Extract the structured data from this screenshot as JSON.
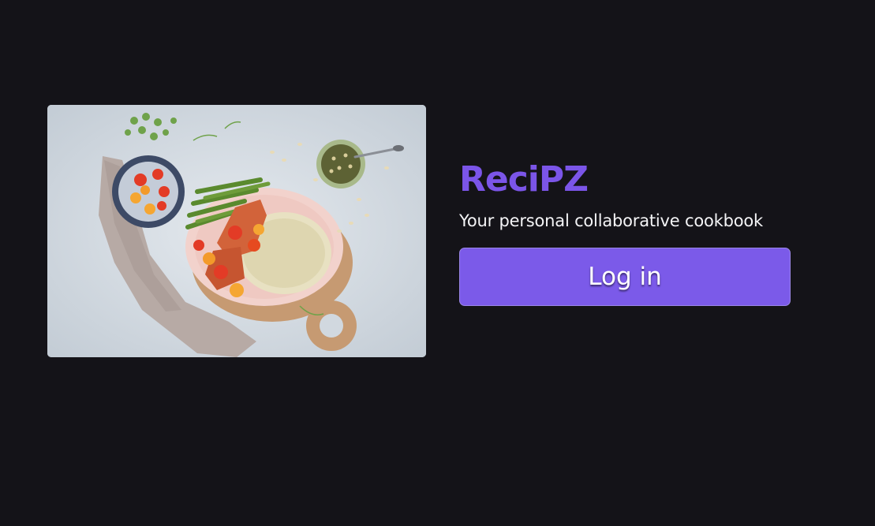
{
  "hero": {
    "image_alt": "Bowl of food with green beans, salmon, tomatoes and couscous on a wooden board"
  },
  "brand": {
    "name": "ReciPZ",
    "tagline": "Your personal collaborative cookbook",
    "accent_color": "#7b55e8"
  },
  "auth": {
    "login_label": "Log in"
  },
  "colors": {
    "background": "#141318",
    "button": "#7b5ae9",
    "text": "#f4f4f6"
  }
}
